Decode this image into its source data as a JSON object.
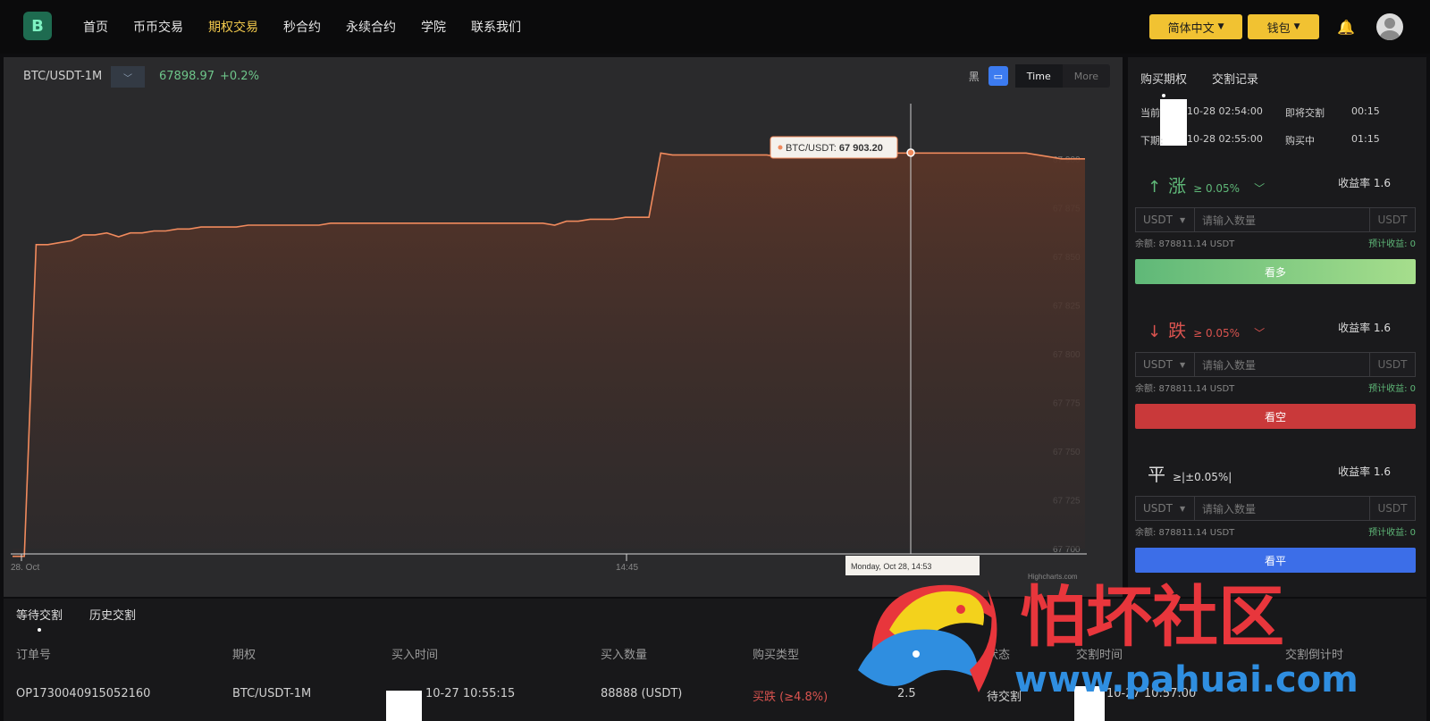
{
  "logo": "B",
  "nav": [
    "首页",
    "币币交易",
    "期权交易",
    "秒合约",
    "永续合约",
    "学院",
    "联系我们"
  ],
  "nav_active": 2,
  "top": {
    "lang": "简体中文",
    "wallet": "钱包"
  },
  "chart": {
    "pair": "BTC/USDT-1M",
    "price": "67898.97",
    "change": "+0.2%",
    "theme_label": "黑",
    "time_btn": "Time",
    "more_btn": "More",
    "tooltip_pair": "BTC/USDT:",
    "tooltip_value": "67 903.20",
    "x_label_tooltip": "Monday, Oct 28, 14:53",
    "credit": "Highcharts.com"
  },
  "chart_data": {
    "type": "area",
    "series": [
      {
        "name": "BTC/USDT",
        "values": [
          67696,
          67696,
          67856,
          67856,
          67857,
          67858,
          67861,
          67861,
          67862,
          67860,
          67862,
          67862,
          67863,
          67863,
          67864,
          67864,
          67865,
          67865,
          67865,
          67865,
          67866,
          67866,
          67866,
          67866,
          67866,
          67866,
          67866,
          67867,
          67867,
          67867,
          67867,
          67867,
          67867,
          67867,
          67867,
          67867,
          67867,
          67867,
          67867,
          67867,
          67867,
          67867,
          67867,
          67867,
          67867,
          67867,
          67866,
          67868,
          67868,
          67869,
          67869,
          67869,
          67870,
          67870,
          67870,
          67903,
          67902,
          67902,
          67902,
          67902,
          67902,
          67902,
          67902,
          67902,
          67902,
          67901,
          67902,
          67901,
          67902,
          67902,
          67902,
          67902,
          67903,
          67903,
          67903,
          67903,
          67903,
          67903,
          67903,
          67903,
          67903,
          67903,
          67903,
          67903,
          67903,
          67903,
          67903,
          67902,
          67901,
          67900,
          67900,
          67900
        ]
      }
    ],
    "xticks": [
      "28. Oct",
      "14:45"
    ],
    "yticks": [
      67700,
      67725,
      67750,
      67775,
      67800,
      67825,
      67850,
      67875,
      67900
    ],
    "ytick_labels": [
      "67 700",
      "67 725",
      "67 750",
      "67 775",
      "67 800",
      "67 825",
      "67 850",
      "67 875",
      "67 900"
    ],
    "ylim": [
      67700,
      67910
    ],
    "line_color": "#f08a5d"
  },
  "orders": {
    "tabs": [
      "等待交割",
      "历史交割"
    ],
    "headers": [
      "订单号",
      "期权",
      "买入时间",
      "买入数量",
      "购买类型",
      "",
      "状态",
      "交割时间",
      "交割倒计时"
    ],
    "row": {
      "id": "OP1730040915052160",
      "option": "BTC/USDT-1M",
      "buy_time": "10-27 10:55:15",
      "qty": "88888 (USDT)",
      "type": "买跌 (≥4.8%)",
      "rate": "2.5",
      "status": "待交割",
      "settle_time": "10-27 10:57:00"
    }
  },
  "side": {
    "tabs": [
      "购买期权",
      "交割记录"
    ],
    "current_label": "当前:",
    "current_time": "10-28 02:54:00",
    "current_status": "即将交割",
    "current_count": "00:15",
    "next_label": "下期:",
    "next_time": "10-28 02:55:00",
    "next_status": "购买中",
    "next_count": "01:15",
    "blocks": [
      {
        "arrow": "↑",
        "label": "涨",
        "th": "≥ 0.05%",
        "rate": "收益率 1.6",
        "cur": "USDT",
        "placeholder": "请输入数量",
        "unit": "USDT",
        "bal": "余额: 878811.14 USDT",
        "est": "预计收益: 0",
        "btn": "看多",
        "btn_color": "#5fb878"
      },
      {
        "arrow": "↓",
        "label": "跌",
        "th": "≥ 0.05%",
        "rate": "收益率 1.6",
        "cur": "USDT",
        "placeholder": "请输入数量",
        "unit": "USDT",
        "bal": "余额: 878811.14 USDT",
        "est": "预计收益: 0",
        "btn": "看空",
        "btn_color": "#c9393a"
      },
      {
        "arrow": "",
        "label": "平",
        "th": "≥|±0.05%|",
        "rate": "收益率 1.6",
        "cur": "USDT",
        "placeholder": "请输入数量",
        "unit": "USDT",
        "bal": "余额: 878811.14 USDT",
        "est": "预计收益: 0",
        "btn": "看平",
        "btn_color": "#3c6ee8"
      }
    ]
  },
  "watermark": {
    "cn": "怕坏社区",
    "url": "www.pahuai.com"
  }
}
